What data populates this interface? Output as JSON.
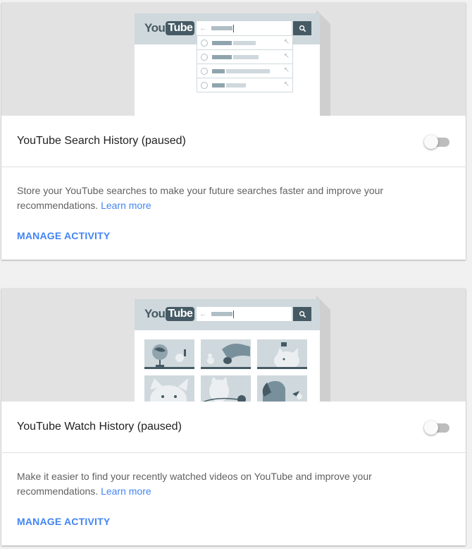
{
  "cards": [
    {
      "title": "YouTube Search History (paused)",
      "toggle_on": false,
      "description": "Store your YouTube searches to make your future searches faster and improve your recommendations.",
      "learn_more": "Learn more",
      "manage": "MANAGE ACTIVITY",
      "illustration": {
        "logo_you": "You",
        "logo_tube": "Tube",
        "type": "search-suggestions"
      }
    },
    {
      "title": "YouTube Watch History (paused)",
      "toggle_on": false,
      "description": "Make it easier to find your recently watched videos on YouTube and improve your recommendations.",
      "learn_more": "Learn more",
      "manage": "MANAGE ACTIVITY",
      "illustration": {
        "logo_you": "You",
        "logo_tube": "Tube",
        "type": "video-thumbnails"
      }
    }
  ],
  "colors": {
    "accent": "#4285f4",
    "illustration_dark": "#455a64",
    "illustration_light": "#cfd8dc",
    "hero_bg": "#e2e2e2"
  }
}
